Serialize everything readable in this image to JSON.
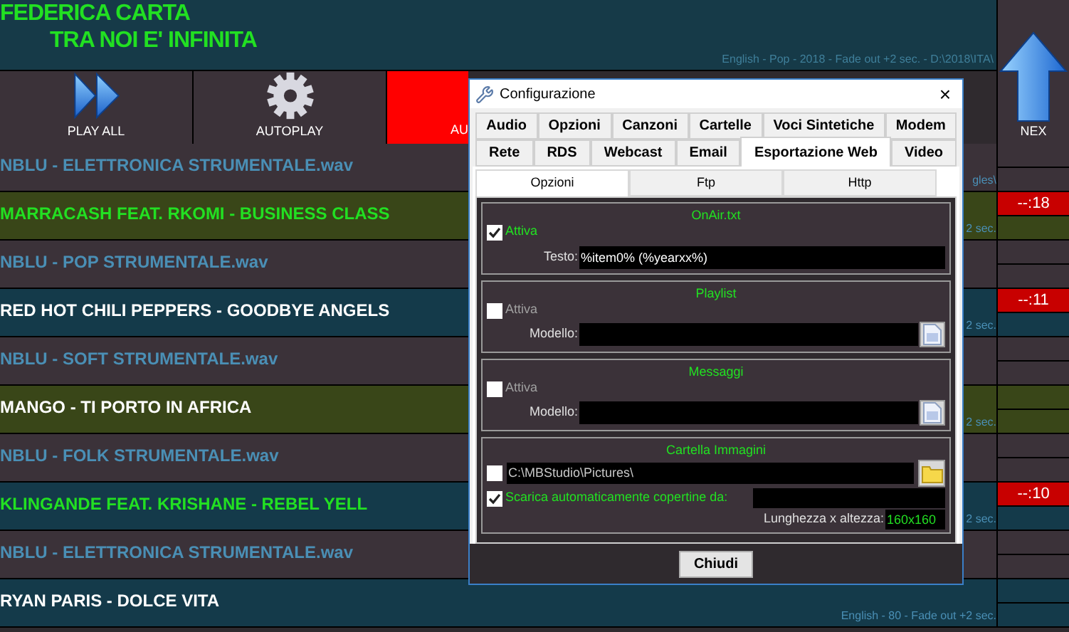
{
  "header": {
    "title": "FEDERICA CARTA",
    "subtitle": "TRA NOI E' INFINITA",
    "info": "English - Pop - 2018 - Fade out +2 sec. - D:\\2018\\ITA\\"
  },
  "buttons": [
    {
      "label": "PLAY ALL",
      "kind": "play"
    },
    {
      "label": "AUTOPLAY",
      "kind": "gear"
    },
    {
      "label": "AU",
      "kind": "alert"
    }
  ],
  "next_button": {
    "label": "NEX"
  },
  "rows": [
    {
      "kind": "jingle",
      "title": "NBLU - ELETTRONICA STRUMENTALE.wav",
      "color": "#4a8fb5",
      "info": "gles\\"
    },
    {
      "kind": "olive",
      "title": "MARRACASH FEAT. RKOMI - BUSINESS CLASS",
      "color": "#22e022",
      "info": "2 sec.",
      "badge": "--:18"
    },
    {
      "kind": "jingle",
      "title": "NBLU - POP STRUMENTALE.wav",
      "color": "#4a8fb5"
    },
    {
      "kind": "teal",
      "title": "RED HOT CHILI PEPPERS - GOODBYE ANGELS",
      "color": "#ffffff",
      "info": "2 sec.",
      "badge": "--:11"
    },
    {
      "kind": "jingle",
      "title": "NBLU - SOFT STRUMENTALE.wav",
      "color": "#4a8fb5"
    },
    {
      "kind": "olive",
      "title": "MANGO - TI PORTO IN AFRICA",
      "color": "#ffffff",
      "info": "2 sec."
    },
    {
      "kind": "jingle",
      "title": "NBLU - FOLK STRUMENTALE.wav",
      "color": "#4a8fb5"
    },
    {
      "kind": "teal",
      "title": "KLINGANDE FEAT. KRISHANE - REBEL YELL",
      "color": "#22e022",
      "info": "2 sec.",
      "badge": "--:10"
    },
    {
      "kind": "jingle",
      "title": "NBLU - ELETTRONICA STRUMENTALE.wav",
      "color": "#4a8fb5"
    },
    {
      "kind": "teal",
      "title": "RYAN PARIS - DOLCE VITA",
      "color": "#ffffff",
      "info": "English - 80 - Fade out +2 sec."
    }
  ],
  "dialog": {
    "title": "Configurazione",
    "close": "×",
    "tab_rows": [
      [
        {
          "label": "Audio",
          "selected": false
        },
        {
          "label": "Opzioni",
          "selected": false
        },
        {
          "label": "Canzoni",
          "selected": false
        },
        {
          "label": "Cartelle",
          "selected": false
        },
        {
          "label": "Voci Sintetiche",
          "selected": false
        },
        {
          "label": "Modem",
          "selected": false
        }
      ],
      [
        {
          "label": "Rete",
          "selected": false
        },
        {
          "label": "RDS",
          "selected": false
        },
        {
          "label": "Webcast",
          "selected": false
        },
        {
          "label": "Email",
          "selected": false
        },
        {
          "label": "Esportazione Web",
          "selected": true
        },
        {
          "label": "Video",
          "selected": false
        }
      ]
    ],
    "subtabs": [
      {
        "label": "Opzioni",
        "selected": true
      },
      {
        "label": "Ftp",
        "selected": false
      },
      {
        "label": "Http",
        "selected": false
      }
    ],
    "groups": [
      {
        "kind": "text",
        "title": "OnAir.txt",
        "checkbox": {
          "label": "Attiva",
          "checked": true
        },
        "field": {
          "label": "Testo:",
          "value": "%item0% (%yearxx%)"
        }
      },
      {
        "kind": "template",
        "title": "Playlist",
        "checkbox": {
          "label": "Attiva",
          "checked": false
        },
        "field": {
          "label": "Modello:"
        }
      },
      {
        "kind": "template",
        "title": "Messaggi",
        "checkbox": {
          "label": "Attiva",
          "checked": false
        },
        "field": {
          "label": "Modello:"
        }
      },
      {
        "kind": "images",
        "title": "Cartella Immagini",
        "path": {
          "checked": false,
          "value": "C:\\MBStudio\\Pictures\\"
        },
        "download": {
          "label": "Scarica automaticamente copertine da:",
          "checked": true
        },
        "size": {
          "label": "Lunghezza x altezza:",
          "value": "160x160"
        }
      }
    ],
    "close_button": "Chiudi"
  }
}
